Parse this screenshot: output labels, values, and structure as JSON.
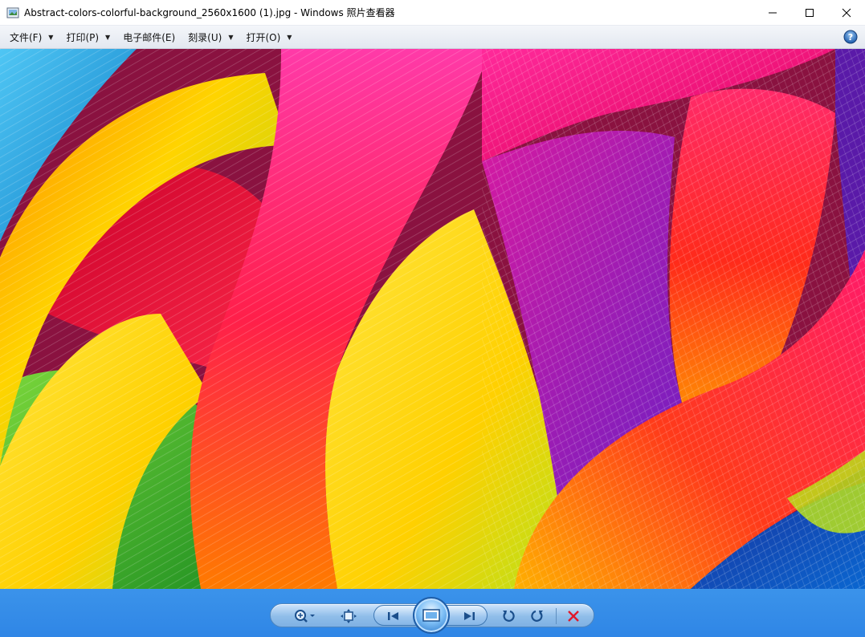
{
  "window": {
    "title": "Abstract-colors-colorful-background_2560x1600 (1).jpg - Windows 照片查看器",
    "icons": [
      "photo-viewer-app-icon",
      "minimize-icon",
      "maximize-icon",
      "close-icon"
    ]
  },
  "menubar": {
    "items": [
      {
        "label": "文件(F)",
        "has_dropdown": true
      },
      {
        "label": "打印(P)",
        "has_dropdown": true
      },
      {
        "label": "电子邮件(E)",
        "has_dropdown": false
      },
      {
        "label": "刻录(U)",
        "has_dropdown": true
      },
      {
        "label": "打开(O)",
        "has_dropdown": true
      }
    ],
    "help_icon": "help-icon"
  },
  "viewer": {
    "image_description_colors": [
      "#1aa0e0",
      "#ffd400",
      "#ff1f7a",
      "#e0005a",
      "#ff2a1a",
      "#ff7a00",
      "#7a2ad6",
      "#2fae2a",
      "#0a3fa8"
    ]
  },
  "controls": {
    "buttons": [
      "zoom-icon",
      "actual-size-icon",
      "previous-icon",
      "slideshow-icon",
      "next-icon",
      "rotate-counterclockwise-icon",
      "rotate-clockwise-icon",
      "delete-icon"
    ],
    "accent": "#2f86e6"
  }
}
